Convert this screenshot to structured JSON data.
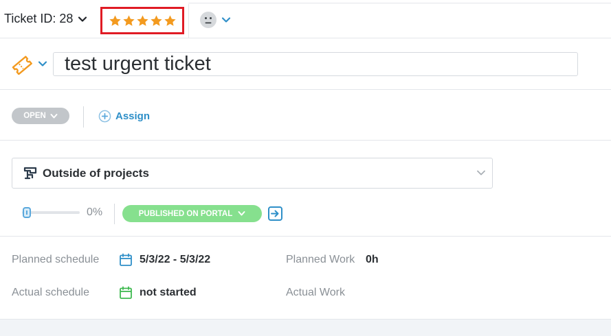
{
  "header": {
    "ticket_id": "Ticket ID: 28",
    "rating": 5,
    "rating_max": 5
  },
  "title": {
    "value": "test urgent ticket"
  },
  "status": {
    "label": "OPEN",
    "assign_label": "Assign"
  },
  "project": {
    "name": "Outside of projects"
  },
  "progress": {
    "value": 0,
    "label": "0%"
  },
  "portal": {
    "label": "PUBLISHED ON PORTAL"
  },
  "schedule": {
    "planned_label": "Planned schedule",
    "planned_value": "5/3/22 - 5/3/22",
    "actual_label": "Actual schedule",
    "actual_value": "not started",
    "planned_work_label": "Planned Work",
    "planned_work_value": "0h",
    "actual_work_label": "Actual Work"
  },
  "colors": {
    "accent": "#2e8fc8",
    "star": "#f39a1f",
    "status_open": "#c2c6ca",
    "published": "#86e08e",
    "highlight_box": "#e01b24"
  }
}
